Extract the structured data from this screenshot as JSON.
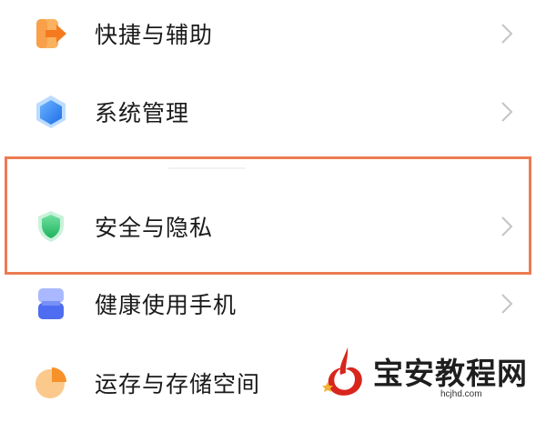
{
  "settings_list": {
    "items": [
      {
        "label": "快捷与辅助",
        "icon": "shortcut-arrow-icon",
        "color": "#f79a2c"
      },
      {
        "label": "系统管理",
        "icon": "hexagon-icon",
        "color": "#2b7cf0"
      },
      {
        "label": "安全与隐私",
        "icon": "shield-icon",
        "color": "#27c36a"
      },
      {
        "label": "健康使用手机",
        "icon": "hourglass-icon",
        "color": "#5a78f0"
      },
      {
        "label": "运存与存储空间",
        "icon": "pie-chart-icon",
        "color": "#f9a13a"
      }
    ],
    "highlighted_item": "安全与隐私",
    "highlight_color": "#ec7b52"
  },
  "watermark": {
    "title": "宝安教程网",
    "domain": "hcjhd.com"
  }
}
